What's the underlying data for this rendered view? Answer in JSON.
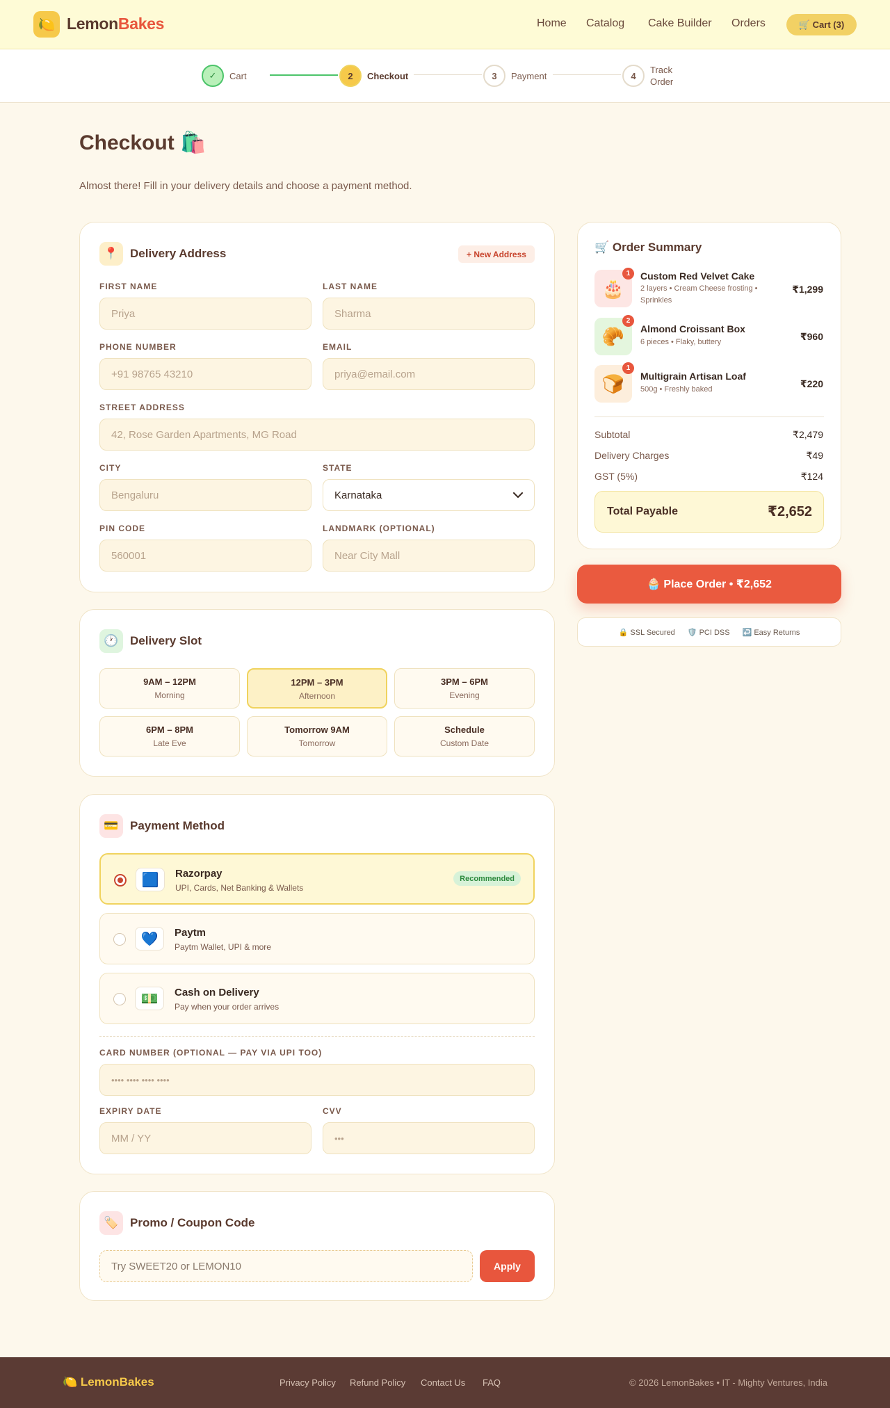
{
  "brand": {
    "icon": "lemon-icon",
    "name_part1": "Lemon",
    "name_part2": "Bakes",
    "logo_glyph": "🍋"
  },
  "nav": {
    "items": [
      "Home",
      "Catalog",
      "Cake Builder",
      "Orders"
    ],
    "cart_label": "🛒 Cart (3)"
  },
  "stepper": {
    "steps": [
      {
        "marker": "✓",
        "label": "Cart",
        "state": "done"
      },
      {
        "marker": "2",
        "label": "Checkout",
        "state": "active"
      },
      {
        "marker": "3",
        "label": "Payment",
        "state": "pending"
      },
      {
        "marker": "4",
        "label": "Track Order",
        "state": "pending"
      }
    ]
  },
  "page": {
    "title": "Checkout 🛍️",
    "subtitle": "Almost there! Fill in your delivery details and choose a payment method."
  },
  "address": {
    "icon_glyph": "📍",
    "title": "Delivery Address",
    "new_address_label": "+ New Address",
    "fields": {
      "first_name": {
        "label": "FIRST NAME",
        "placeholder": "Priya"
      },
      "last_name": {
        "label": "LAST NAME",
        "placeholder": "Sharma"
      },
      "phone": {
        "label": "PHONE NUMBER",
        "placeholder": "+91 98765 43210"
      },
      "email": {
        "label": "EMAIL",
        "placeholder": "priya@email.com"
      },
      "street": {
        "label": "STREET ADDRESS",
        "placeholder": "42, Rose Garden Apartments, MG Road"
      },
      "city": {
        "label": "CITY",
        "placeholder": "Bengaluru"
      },
      "state": {
        "label": "STATE",
        "value": "Karnataka"
      },
      "pin": {
        "label": "PIN CODE",
        "placeholder": "560001"
      },
      "landmark": {
        "label": "LANDMARK (OPTIONAL)",
        "placeholder": "Near City Mall"
      }
    }
  },
  "slots": {
    "icon_glyph": "🕐",
    "title": "Delivery Slot",
    "items": [
      {
        "time": "9AM – 12PM",
        "sub": "Morning"
      },
      {
        "time": "12PM – 3PM",
        "sub": "Afternoon",
        "selected": true
      },
      {
        "time": "3PM – 6PM",
        "sub": "Evening"
      },
      {
        "time": "6PM – 8PM",
        "sub": "Late Eve"
      },
      {
        "time": "Tomorrow 9AM",
        "sub": "Tomorrow"
      },
      {
        "time": "Schedule",
        "sub": "Custom Date"
      }
    ]
  },
  "payment": {
    "icon_glyph": "💳",
    "title": "Payment Method",
    "methods": [
      {
        "name": "Razorpay",
        "desc": "UPI, Cards, Net Banking & Wallets",
        "badge": "Recommended",
        "icon_glyph": "🟦",
        "selected": true
      },
      {
        "name": "Paytm",
        "desc": "Paytm Wallet, UPI & more",
        "icon_glyph": "💙"
      },
      {
        "name": "Cash on Delivery",
        "desc": "Pay when your order arrives",
        "icon_glyph": "💵"
      }
    ],
    "card_number": {
      "label": "CARD NUMBER (OPTIONAL — PAY VIA UPI TOO)",
      "placeholder": "•••• •••• •••• ••••"
    },
    "expiry": {
      "label": "EXPIRY DATE",
      "placeholder": "MM / YY"
    },
    "cvv": {
      "label": "CVV",
      "placeholder": "•••"
    }
  },
  "promo": {
    "icon_glyph": "🏷️",
    "title": "Promo / Coupon Code",
    "placeholder": "Try SWEET20 or LEMON10",
    "apply_label": "Apply"
  },
  "summary": {
    "title": "🛒 Order Summary",
    "items": [
      {
        "qty": "1",
        "name": "Custom Red Velvet Cake",
        "desc": "2 layers • Cream Cheese frosting • Sprinkles",
        "price": "₹1,299",
        "glyph": "🎂"
      },
      {
        "qty": "2",
        "name": "Almond Croissant Box",
        "desc": "6 pieces • Flaky, buttery",
        "price": "₹960",
        "glyph": "🥐"
      },
      {
        "qty": "1",
        "name": "Multigrain Artisan Loaf",
        "desc": "500g • Freshly baked",
        "price": "₹220",
        "glyph": "🍞"
      }
    ],
    "subtotal_label": "Subtotal",
    "subtotal": "₹2,479",
    "delivery_label": "Delivery Charges",
    "delivery": "₹49",
    "gst_label": "GST (5%)",
    "gst": "₹124",
    "total_label": "Total Payable",
    "total": "₹2,652"
  },
  "place_order_label": "🧁 Place Order • ₹2,652",
  "trust": [
    "🔒 SSL Secured",
    "🛡️ PCI DSS",
    "↩️ Easy Returns"
  ],
  "footer": {
    "logo": "🍋 LemonBakes",
    "links": [
      "Privacy Policy",
      "Refund Policy",
      "Contact Us",
      "FAQ"
    ],
    "copyright": "© 2026 LemonBakes • IT - Mighty Ventures, India"
  },
  "colors": {
    "accent": "#e8563d",
    "brand_yellow": "#f6c94a",
    "background": "#fdf8ec",
    "success": "#4cc46a"
  }
}
